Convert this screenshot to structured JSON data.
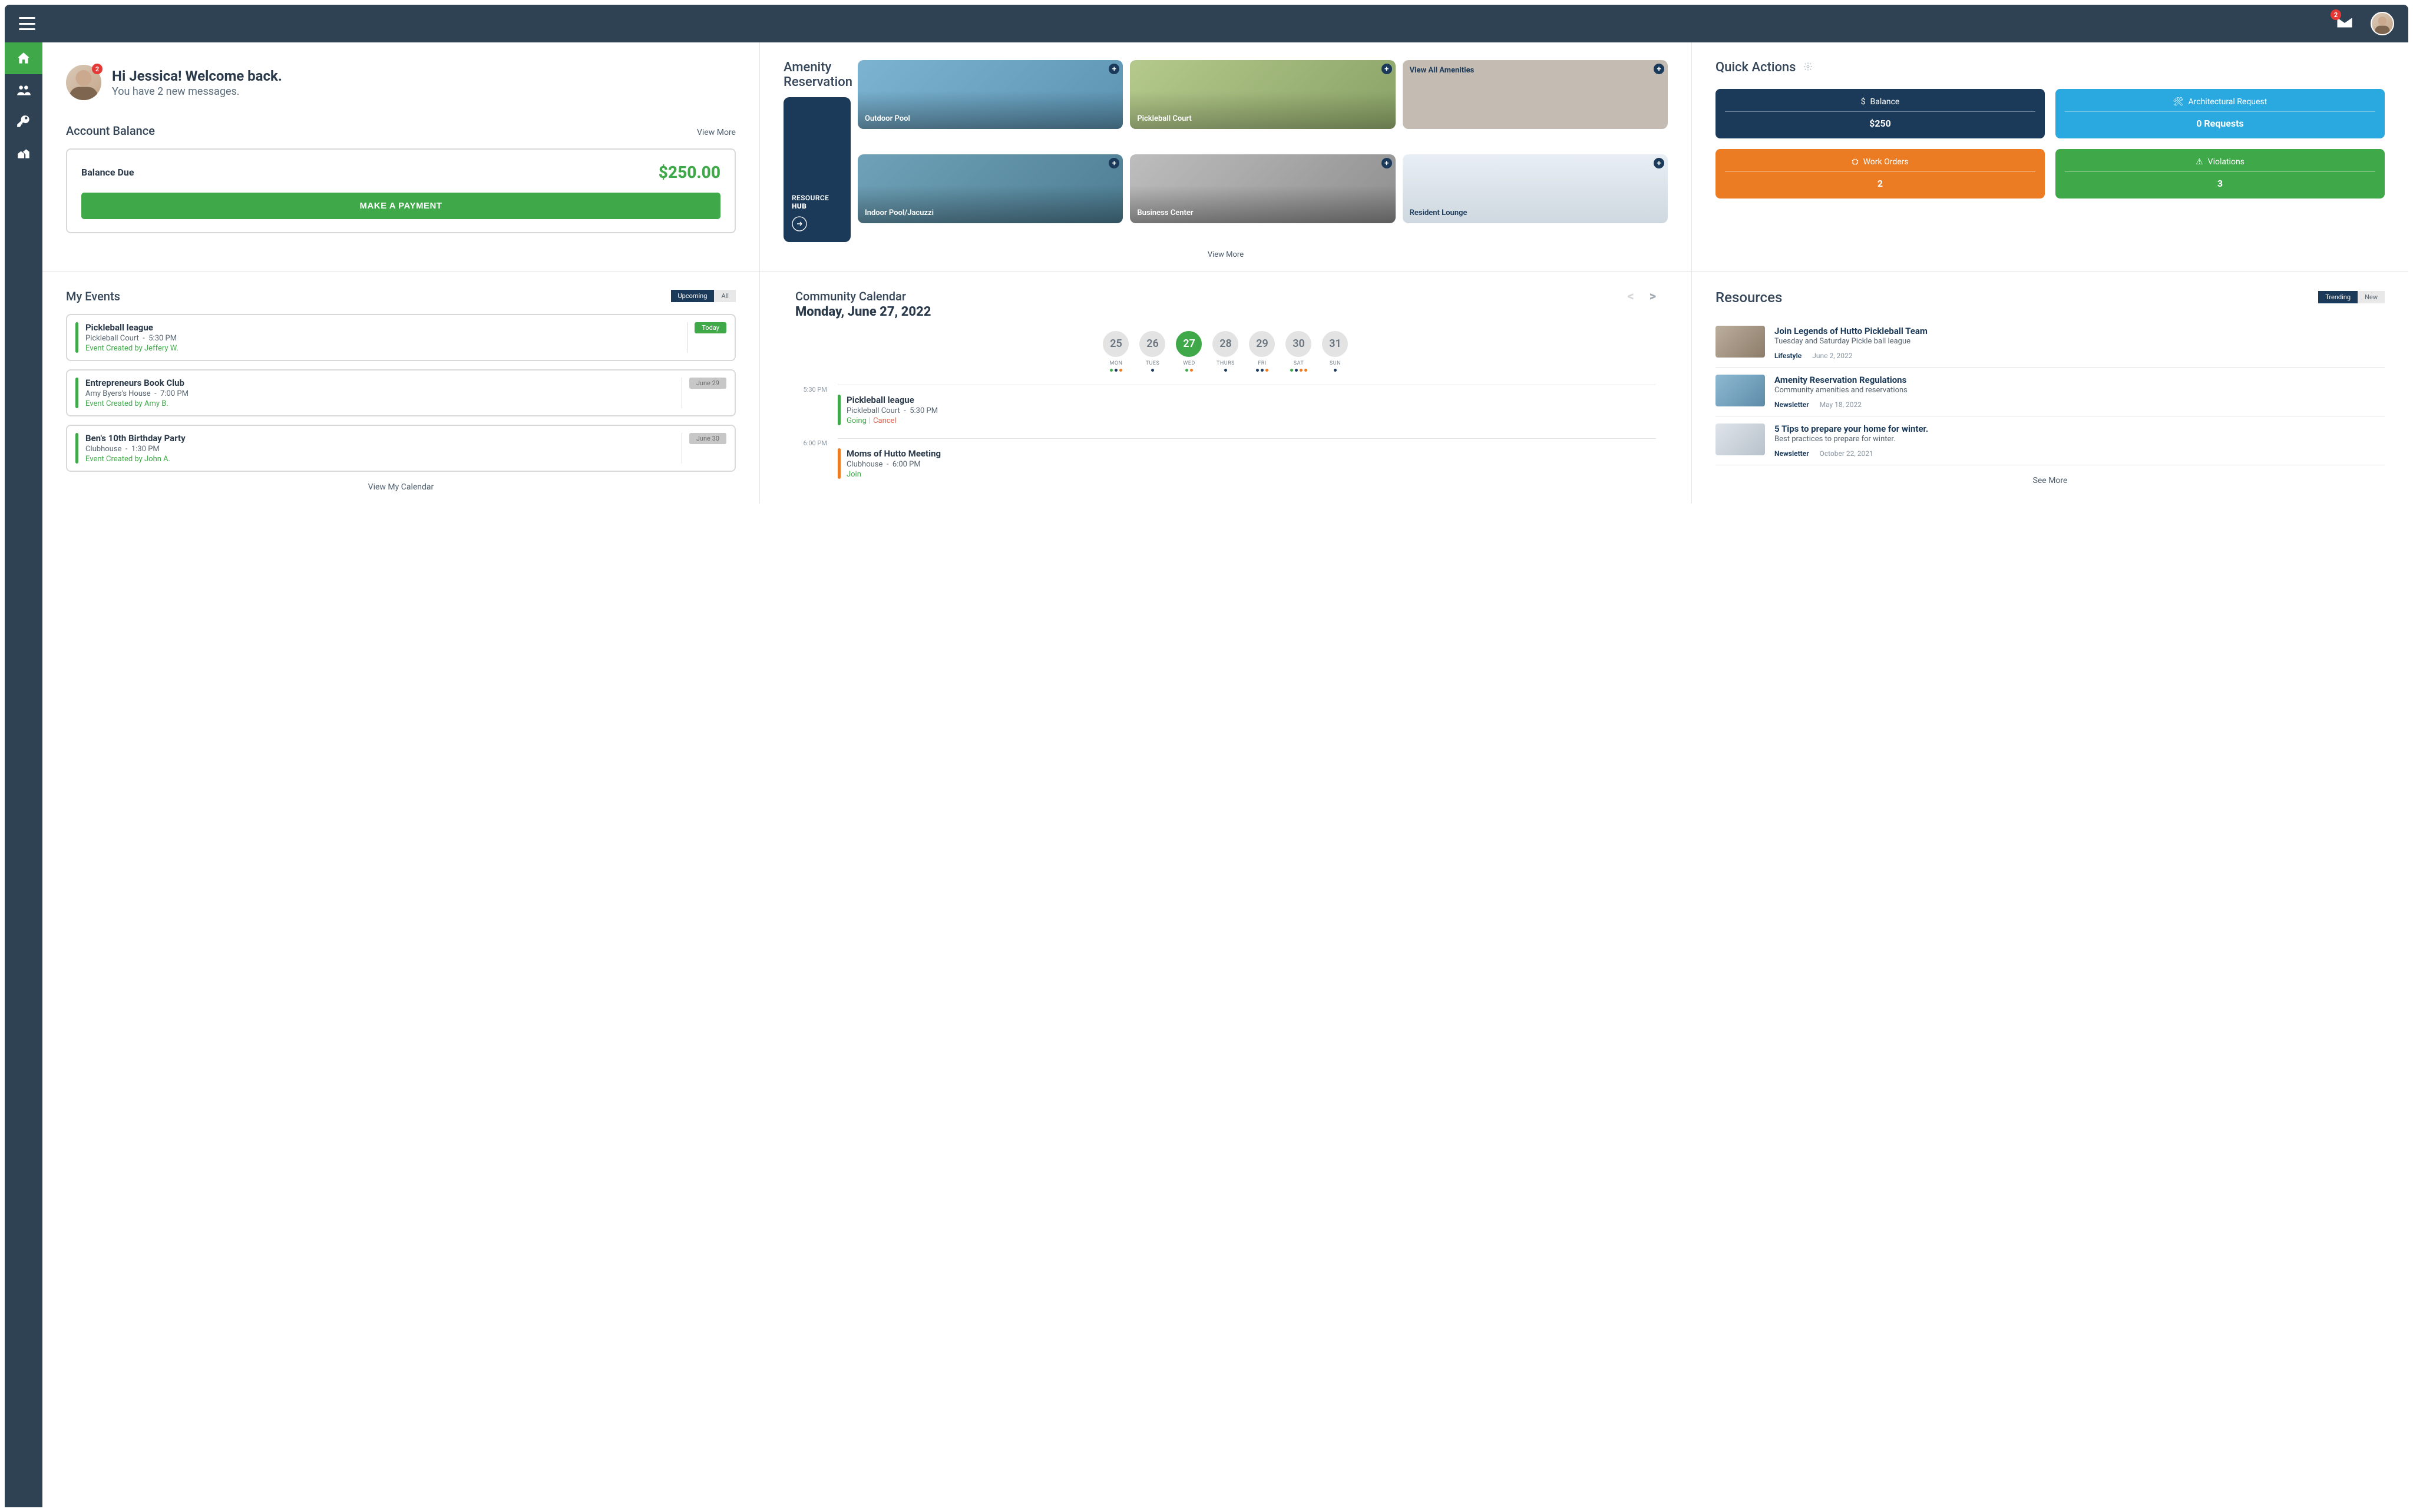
{
  "topbar": {
    "notification_count": "2"
  },
  "sidebar": {
    "items": [
      "home",
      "people",
      "key",
      "houses"
    ]
  },
  "welcome": {
    "greeting": "Hi Jessica! Welcome back.",
    "sub": "You have 2 new messages.",
    "badge": "2"
  },
  "balance": {
    "heading": "Account Balance",
    "view_more": "View More",
    "label": "Balance Due",
    "amount": "$250.00",
    "btn": "MAKE A PAYMENT"
  },
  "amenity": {
    "heading_l1": "Amenity",
    "heading_l2": "Reservation",
    "resource_hub_l1": "RESOURCE",
    "resource_hub_l2": "HUB",
    "cards": [
      {
        "label": "Outdoor Pool"
      },
      {
        "label": "Pickleball Court"
      },
      {
        "label": "View All Amenities"
      },
      {
        "label": "Indoor Pool/Jacuzzi"
      },
      {
        "label": "Business Center"
      },
      {
        "label": "Resident Lounge"
      }
    ],
    "view_more": "View More"
  },
  "quick": {
    "heading": "Quick Actions",
    "cards": [
      {
        "top": "Balance",
        "val": "$250"
      },
      {
        "top": "Architectural Request",
        "val": "0 Requests"
      },
      {
        "top": "Work Orders",
        "val": "2"
      },
      {
        "top": "Violations",
        "val": "3"
      }
    ]
  },
  "events": {
    "heading": "My Events",
    "tabs": {
      "upcoming": "Upcoming",
      "all": "All"
    },
    "items": [
      {
        "title": "Pickleball league",
        "where": "Pickleball Court",
        "time": "5:30 PM",
        "creator": "Event Created by Jeffery W.",
        "badge": "Today",
        "badge_cls": "badge-today"
      },
      {
        "title": "Entrepreneurs Book Club",
        "where": "Amy Byers's House",
        "time": "7:00 PM",
        "creator": "Event Created by Amy B.",
        "badge": "June 29",
        "badge_cls": "badge-grey"
      },
      {
        "title": "Ben's 10th Birthday Party",
        "where": "Clubhouse",
        "time": "1:30 PM",
        "creator": "Event Created by John A.",
        "badge": "June 30",
        "badge_cls": "badge-grey"
      }
    ],
    "footer": "View My Calendar"
  },
  "calendar": {
    "heading": "Community Calendar",
    "date": "Monday, June 27, 2022",
    "days": [
      {
        "num": "25",
        "lbl": "MON",
        "dots": [
          "dg",
          "db",
          "do"
        ]
      },
      {
        "num": "26",
        "lbl": "TUES",
        "dots": [
          "db"
        ]
      },
      {
        "num": "27",
        "lbl": "WED",
        "dots": [
          "dg",
          "do"
        ],
        "active": true
      },
      {
        "num": "28",
        "lbl": "THURS",
        "dots": [
          "db"
        ]
      },
      {
        "num": "29",
        "lbl": "FRI",
        "dots": [
          "db",
          "db",
          "do"
        ]
      },
      {
        "num": "30",
        "lbl": "SAT",
        "dots": [
          "dg",
          "db",
          "do",
          "do"
        ]
      },
      {
        "num": "31",
        "lbl": "SUN",
        "dots": [
          "db"
        ]
      }
    ],
    "slots": [
      {
        "time": "5:30 PM",
        "bar": "#3fa94a",
        "title": "Pickleball league",
        "where": "Pickleball Court",
        "when": "5:30 PM",
        "actions": {
          "going": "Going",
          "cancel": "Cancel"
        }
      },
      {
        "time": "6:00 PM",
        "bar": "#ec7c23",
        "title": "Moms of Hutto Meeting",
        "where": "Clubhouse",
        "when": "6:00 PM",
        "actions": {
          "join": "Join"
        }
      }
    ]
  },
  "resources": {
    "heading": "Resources",
    "tabs": {
      "trending": "Trending",
      "new": "New"
    },
    "items": [
      {
        "title": "Join Legends of Hutto Pickleball Team",
        "sub": "Tuesday and Saturday Pickle ball league",
        "tag": "Lifestyle",
        "date": "June 2, 2022",
        "thumb": "rt1"
      },
      {
        "title": "Amenity Reservation Regulations",
        "sub": "Community amenities and reservations",
        "tag": "Newsletter",
        "date": "May 18, 2022",
        "thumb": "rt2"
      },
      {
        "title": "5 Tips to prepare your home for winter.",
        "sub": "Best practices to prepare for winter.",
        "tag": "Newsletter",
        "date": "October 22, 2021",
        "thumb": "rt3"
      }
    ],
    "footer": "See More"
  }
}
